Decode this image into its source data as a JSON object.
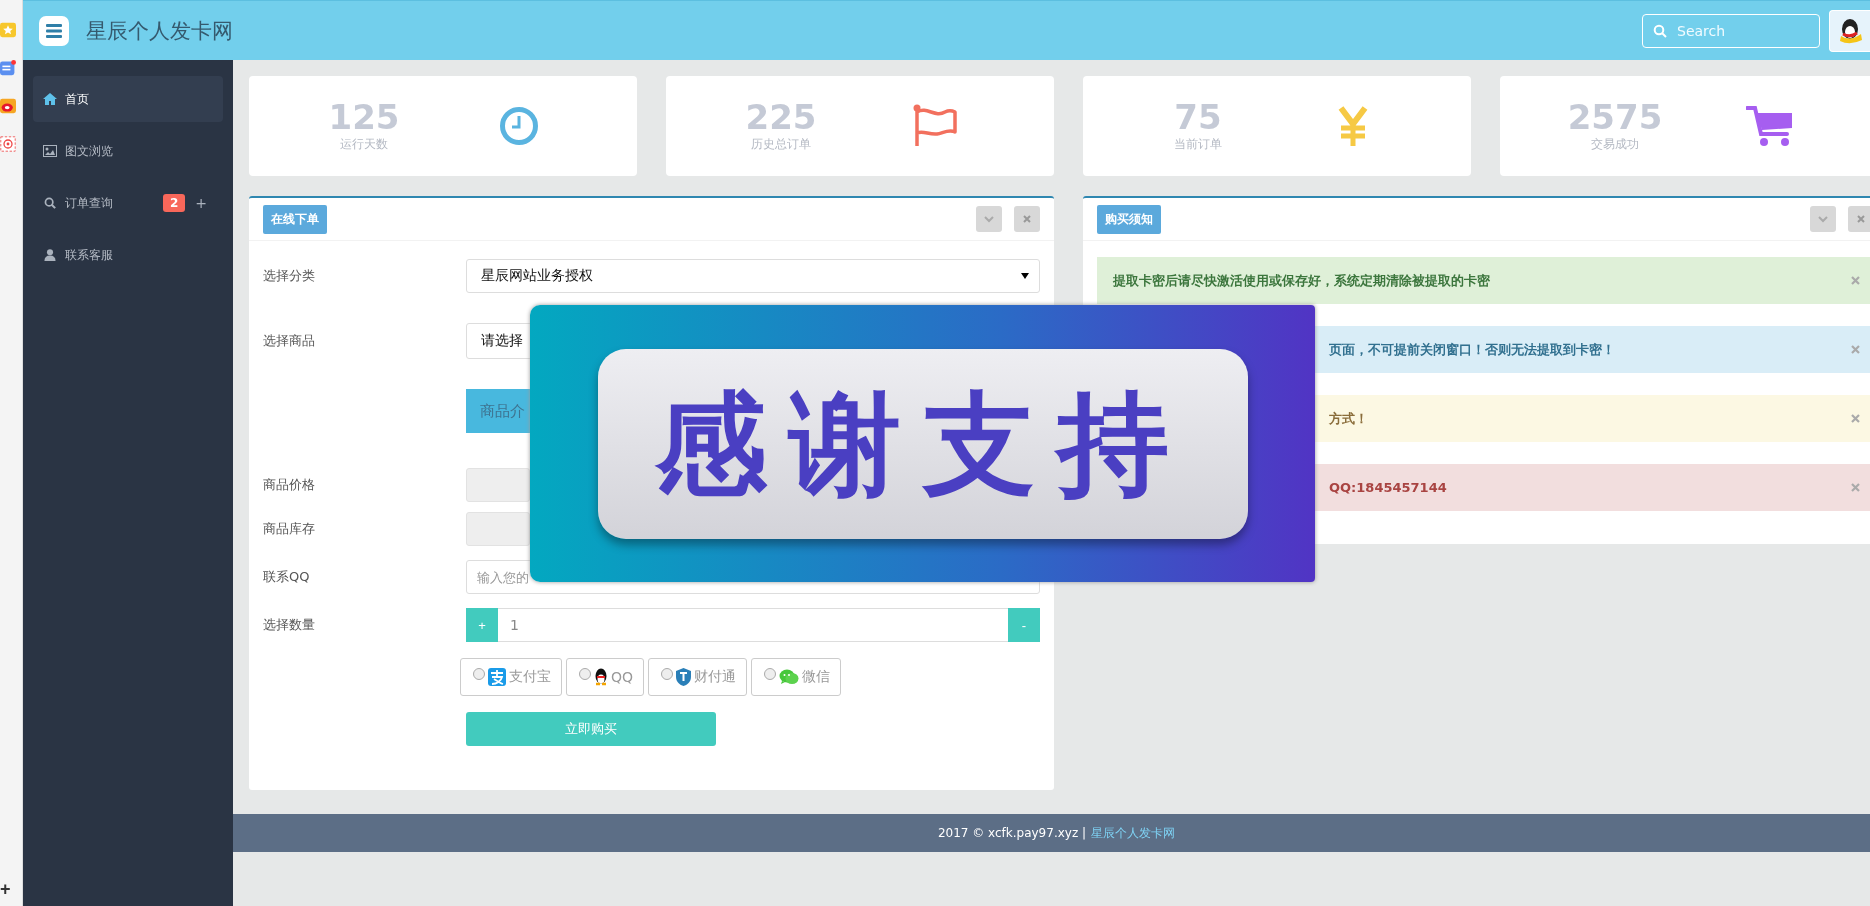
{
  "browser_sidebar": {
    "add": "+"
  },
  "header": {
    "title": "星辰个人发卡网",
    "search": {
      "placeholder": "Search"
    }
  },
  "sidebar": {
    "items": [
      {
        "label": "首页",
        "selected": true
      },
      {
        "label": "图文浏览",
        "selected": false
      },
      {
        "label": "订单查询",
        "selected": false,
        "badge": "2",
        "more": "+"
      },
      {
        "label": "联系客服",
        "selected": false
      }
    ]
  },
  "stats": [
    {
      "value": "125",
      "label": "运行天数",
      "color": "#5ab4e0"
    },
    {
      "value": "225",
      "label": "历史总订单",
      "color": "#f2705e"
    },
    {
      "value": "75",
      "label": "当前订单",
      "color": "#f6c944"
    },
    {
      "value": "2575",
      "label": "交易成功",
      "color": "#a65ef0"
    }
  ],
  "order_panel": {
    "title": "在线下单",
    "category": {
      "label": "选择分类",
      "value": "星辰网站业务授权"
    },
    "product": {
      "label": "选择商品",
      "value": "请选择"
    },
    "intro_button": "商品介",
    "price": {
      "label": "商品价格"
    },
    "stock": {
      "label": "商品库存"
    },
    "qq": {
      "label": "联系QQ",
      "placeholder": "输入您的"
    },
    "quantity": {
      "label": "选择数量",
      "plus": "+",
      "value": "1",
      "minus": "-"
    },
    "payments": [
      {
        "label": "支付宝",
        "selected": false
      },
      {
        "label": "QQ",
        "selected": false
      },
      {
        "label": "财付通",
        "selected": false
      },
      {
        "label": "微信",
        "selected": false
      }
    ],
    "buy_button": "立即购买"
  },
  "notice_panel": {
    "title": "购买须知",
    "alerts": [
      {
        "kind": "success",
        "text": "提取卡密后请尽快激活使用或保存好，系统定期清除被提取的卡密"
      },
      {
        "kind": "info",
        "text": "页面，不可提前关闭窗口！否则无法提取到卡密！"
      },
      {
        "kind": "warning",
        "text": "方式！"
      },
      {
        "kind": "danger",
        "text": "QQ:1845457144"
      }
    ]
  },
  "overlay": {
    "text": "感谢支持"
  },
  "footer": {
    "text": "2017 © xcfk.pay97.xyz |",
    "link": "星辰个人发卡网"
  }
}
